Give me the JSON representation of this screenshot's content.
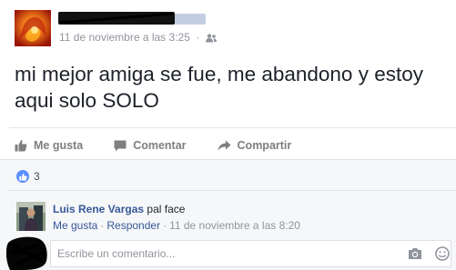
{
  "post": {
    "author_name": "",
    "timestamp": "11 de noviembre a las 3:25",
    "separator": "·",
    "audience_icon": "friends-icon",
    "text": "mi mejor amiga se fue, me abandono y estoy aqui solo SOLO"
  },
  "actions": {
    "like_label": "Me gusta",
    "comment_label": "Comentar",
    "share_label": "Compartir"
  },
  "likes": {
    "count": "3",
    "icon": "thumbs-up-icon"
  },
  "comment": {
    "author": "Luis Rene Vargas",
    "text": "pal face",
    "like_link": "Me gusta",
    "reply_link": "Responder",
    "separator": "·",
    "timestamp": "11 de noviembre a las 8:20"
  },
  "write_comment": {
    "placeholder": "Escribe un comentario...",
    "camera_icon": "camera-icon",
    "emoji_icon": "emoji-icon"
  },
  "colors": {
    "link": "#365899",
    "secondary_text": "#90949c",
    "like_badge": "#5890ff",
    "feedback_bg": "#f6f7f9"
  }
}
